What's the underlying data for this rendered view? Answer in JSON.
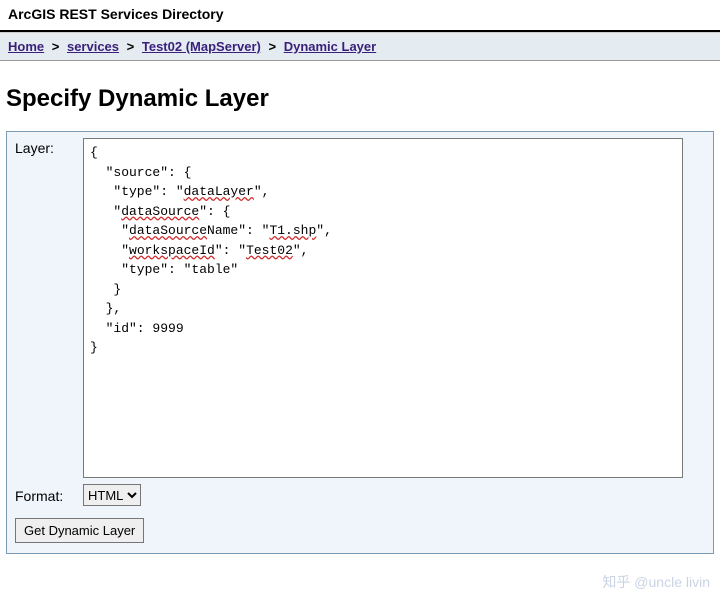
{
  "header": {
    "title": "ArcGIS REST Services Directory"
  },
  "breadcrumb": {
    "items": [
      {
        "label": "Home"
      },
      {
        "label": "services"
      },
      {
        "label": "Test02 (MapServer)"
      },
      {
        "label": "Dynamic Layer"
      }
    ],
    "sep": ">"
  },
  "page": {
    "title": "Specify Dynamic Layer"
  },
  "form": {
    "layer_label": "Layer:",
    "layer_value": "{\n  \"source\": {\n   \"type\": \"dataLayer\",\n   \"dataSource\": {\n    \"dataSourceName\": \"T1.shp\",\n    \"workspaceId\": \"Test02\",\n    \"type\": \"table\"\n   }\n  },\n  \"id\": 9999\n}",
    "format_label": "Format:",
    "format_value": "HTML",
    "format_options": [
      "HTML"
    ],
    "submit_label": "Get Dynamic Layer"
  },
  "spell_tokens": [
    "dataLayer",
    "dataSource",
    "dataSourceName",
    "T1.shp",
    "workspaceId",
    "Test02"
  ],
  "watermark": "知乎 @uncle livin"
}
